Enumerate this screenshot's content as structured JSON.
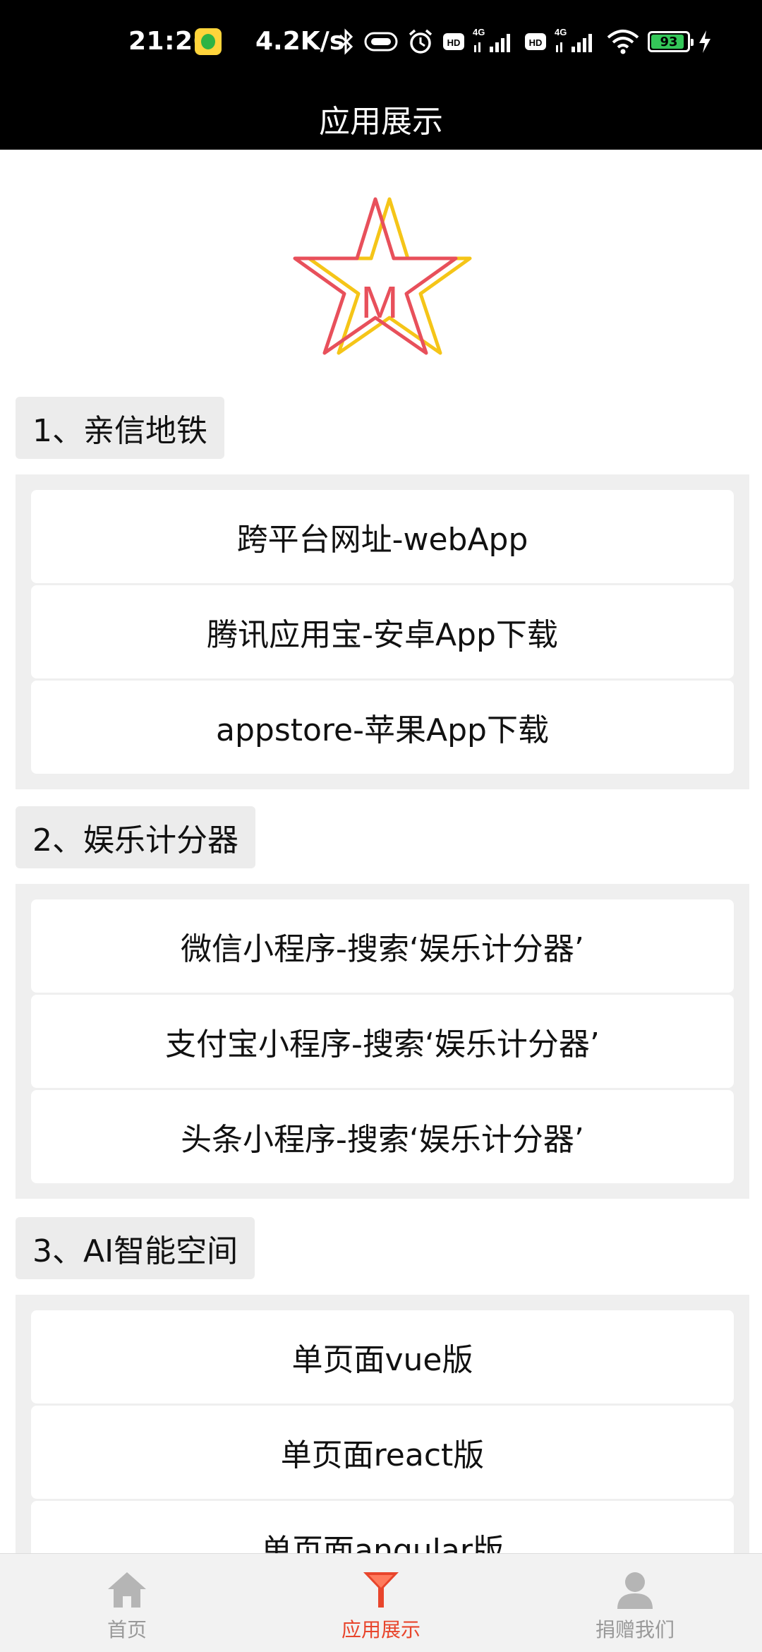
{
  "status_bar": {
    "time": "21:26",
    "network_speed": "4.2K/s",
    "battery_level": "93",
    "icons": [
      "mini-app-icon",
      "bluetooth-icon",
      "vibrate-icon",
      "alarm-icon",
      "hd-icon",
      "signal-4g-icon",
      "hd-icon",
      "signal-4g-icon",
      "wifi-icon",
      "battery-icon",
      "charging-icon"
    ]
  },
  "header": {
    "title": "应用展示"
  },
  "logo": {
    "letter": "M",
    "colors": {
      "red_star": "#e8505b",
      "yellow_star": "#f5c518"
    }
  },
  "sections": [
    {
      "title": "1、亲信地铁",
      "items": [
        "跨平台网址-webApp",
        "腾讯应用宝-安卓App下载",
        "appstore-苹果App下载"
      ]
    },
    {
      "title": "2、娱乐计分器",
      "items": [
        "微信小程序-搜索‘娱乐计分器’",
        "支付宝小程序-搜索‘娱乐计分器’",
        "头条小程序-搜索‘娱乐计分器’"
      ]
    },
    {
      "title": "3、AI智能空间",
      "items": [
        "单页面vue版",
        "单页面react版",
        "单页面angular版"
      ]
    }
  ],
  "bottom_nav": {
    "items": [
      {
        "label": "首页",
        "icon": "home-icon",
        "active": false
      },
      {
        "label": "应用展示",
        "icon": "app-showcase-icon",
        "active": true
      },
      {
        "label": "捐赠我们",
        "icon": "user-icon",
        "active": false
      }
    ]
  },
  "colors": {
    "accent": "#e8452c",
    "inactive": "#999999",
    "header_bg": "#000000",
    "section_bg": "#efefef"
  }
}
